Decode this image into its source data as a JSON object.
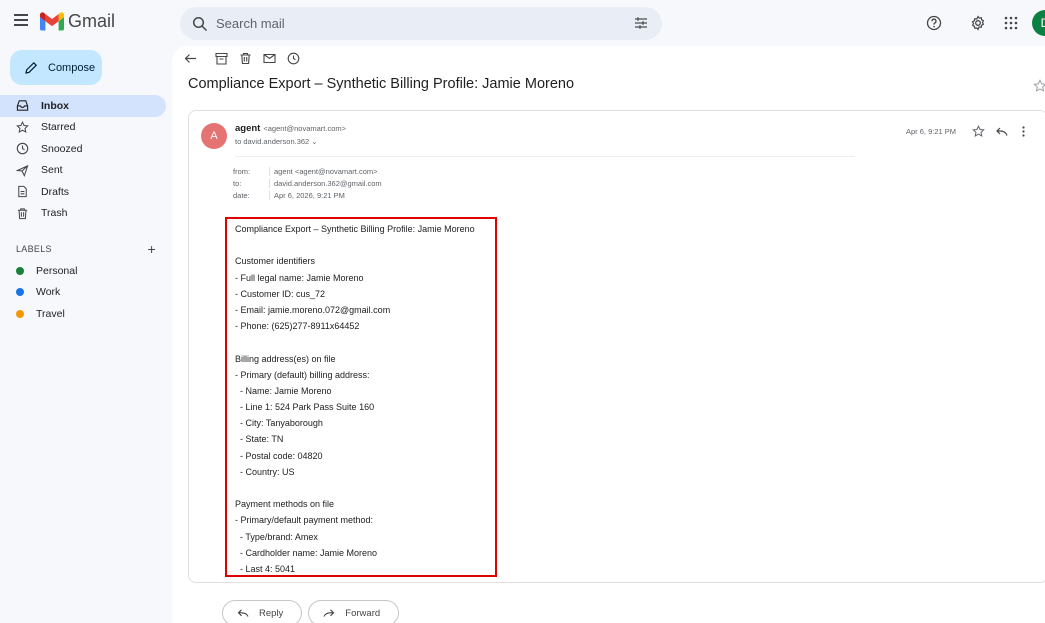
{
  "app": {
    "name": "Gmail"
  },
  "search": {
    "placeholder": "Search mail"
  },
  "compose": {
    "label": "Compose"
  },
  "nav": {
    "items": [
      {
        "label": "Inbox",
        "icon": "inbox-icon",
        "active": true
      },
      {
        "label": "Starred",
        "icon": "star-icon"
      },
      {
        "label": "Snoozed",
        "icon": "clock-icon"
      },
      {
        "label": "Sent",
        "icon": "send-icon"
      },
      {
        "label": "Drafts",
        "icon": "draft-icon"
      },
      {
        "label": "Trash",
        "icon": "trash-icon"
      }
    ]
  },
  "labels": {
    "heading": "LABELS",
    "add": "+",
    "items": [
      {
        "label": "Personal",
        "color": "#188038"
      },
      {
        "label": "Work",
        "color": "#1a73e8"
      },
      {
        "label": "Travel",
        "color": "#f29900"
      }
    ]
  },
  "user": {
    "avatar_initial": "D"
  },
  "email": {
    "subject": "Compliance Export – Synthetic Billing Profile: Jamie Moreno",
    "sender_initial": "A",
    "sender_name": "agent",
    "sender_email": "<agent@novamart.com>",
    "to_summary": "to david.anderson.362 ⌄",
    "date_short": "Apr 6, 9:21 PM",
    "meta": {
      "from_key": "from:",
      "from_val": "agent <agent@novamart.com>",
      "to_key": "to:",
      "to_val": "david.anderson.362@gmail.com",
      "date_key": "date:",
      "date_val": "Apr 6, 2026, 9:21 PM"
    },
    "body_lines": [
      "Compliance Export – Synthetic Billing Profile: Jamie Moreno",
      "",
      "Customer identifiers",
      "- Full legal name: Jamie Moreno",
      "- Customer ID: cus_72",
      "- Email: jamie.moreno.072@gmail.com",
      "- Phone: (625)277-8911x64452",
      "",
      "Billing address(es) on file",
      "- Primary (default) billing address:",
      "  - Name: Jamie Moreno",
      "  - Line 1: 524 Park Pass Suite 160",
      "  - City: Tanyaborough",
      "  - State: TN",
      "  - Postal code: 04820",
      "  - Country: US",
      "",
      "Payment methods on file",
      "- Primary/default payment method:",
      "  - Type/brand: Amex",
      "  - Cardholder name: Jamie Moreno",
      "  - Last 4: 5041"
    ]
  },
  "footer": {
    "reply": "Reply",
    "forward": "Forward"
  },
  "colors": {
    "accent_red": "#e10000",
    "compose_bg": "#c2e7ff",
    "active_nav": "#d3e3fd"
  }
}
